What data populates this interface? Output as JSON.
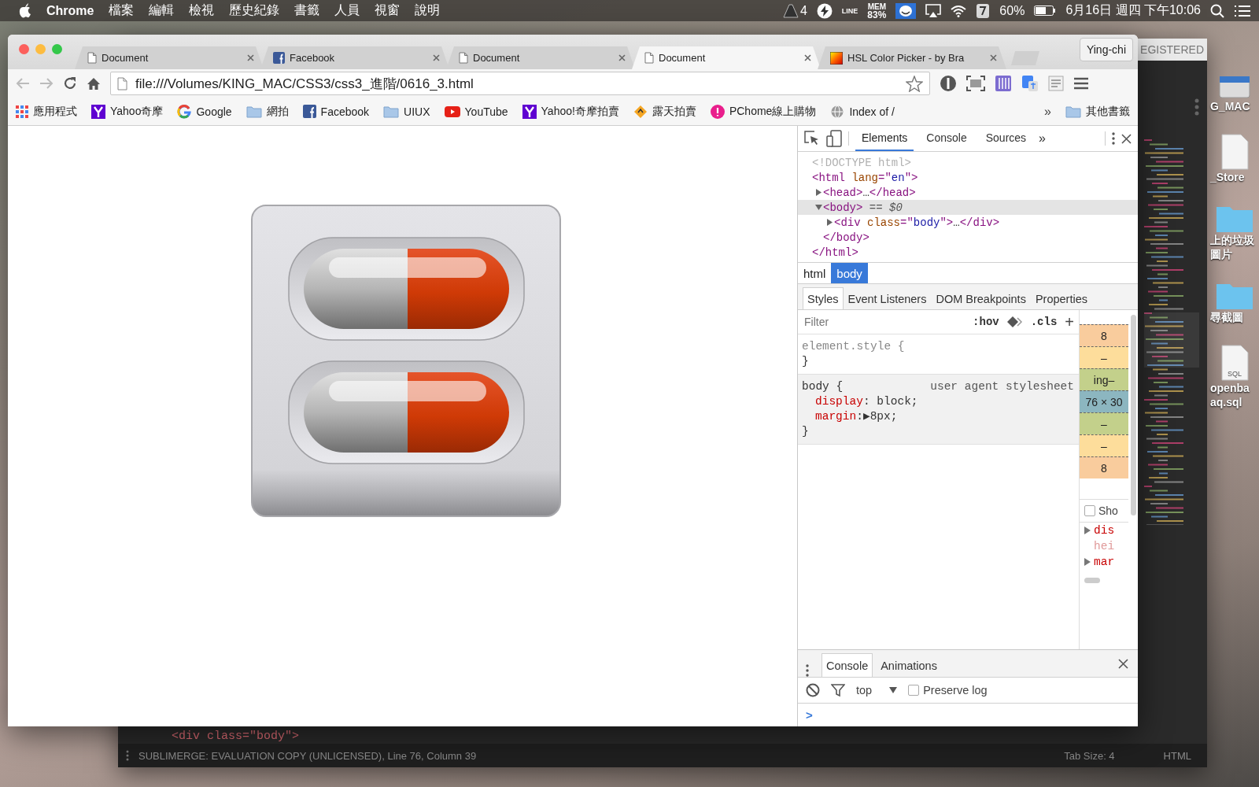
{
  "menu_bar": {
    "app": "Chrome",
    "menus": [
      "檔案",
      "編輯",
      "檢視",
      "歷史紀錄",
      "書籤",
      "人員",
      "視窗",
      "說明"
    ],
    "adobe_count": "4",
    "line_label": "LINE",
    "mem_label": "MEM",
    "mem_value": "83%",
    "battery_percent": "60%",
    "clock": "6月16日 週四 下午10:06"
  },
  "background_window": {
    "title": "EGISTERED",
    "code_line": "<div class=\"body\">",
    "status": "SUBLIMERGE: EVALUATION COPY (UNLICENSED), Line 76, Column 39",
    "tab_size": "Tab Size: 4",
    "syntax": "HTML"
  },
  "desktop_icons": [
    {
      "kind": "drive",
      "label": "G_MAC"
    },
    {
      "kind": "file",
      "label": "_Store"
    },
    {
      "kind": "folder",
      "label": "上的垃圾圖片"
    },
    {
      "kind": "folder",
      "label": "尋截圖"
    },
    {
      "kind": "sql",
      "badge": "SQL",
      "label": "openba\naq.sql"
    }
  ],
  "browser": {
    "tabs": [
      {
        "title": "Document",
        "kind": "page",
        "selected": false
      },
      {
        "title": "Facebook",
        "kind": "facebook",
        "selected": false
      },
      {
        "title": "Document",
        "kind": "page",
        "selected": false
      },
      {
        "title": "Document",
        "kind": "page",
        "selected": true
      },
      {
        "title": "HSL Color Picker - by Bra",
        "kind": "swatch",
        "selected": false
      }
    ],
    "profile": "Ying-chi",
    "url": "file:///Volumes/KING_MAC/CSS3/css3_進階/0616_3.html",
    "bookmarks": [
      {
        "kind": "apps",
        "label": "應用程式"
      },
      {
        "kind": "yahoo",
        "label": "Yahoo奇摩"
      },
      {
        "kind": "google",
        "label": "Google"
      },
      {
        "kind": "folder",
        "label": "網拍"
      },
      {
        "kind": "facebook",
        "label": "Facebook"
      },
      {
        "kind": "folder",
        "label": "UIUX"
      },
      {
        "kind": "youtube",
        "label": "YouTube"
      },
      {
        "kind": "yahoo",
        "label": "Yahoo!奇摩拍賣"
      },
      {
        "kind": "ruten",
        "label": "露天拍賣"
      },
      {
        "kind": "pchome",
        "label": "PChome線上購物"
      },
      {
        "kind": "globe",
        "label": "Index of /"
      }
    ],
    "bookmarks_overflow": "»",
    "other_bookmarks": "其他書籤"
  },
  "devtools": {
    "tabs": [
      {
        "label": "Elements",
        "selected": true
      },
      {
        "label": "Console",
        "selected": false
      },
      {
        "label": "Sources",
        "selected": false
      }
    ],
    "more_tabs": "»",
    "dom_tree": [
      {
        "selected": false,
        "tokens": [
          {
            "kind": "doctype",
            "text": "<!DOCTYPE html>"
          }
        ]
      },
      {
        "selected": false,
        "tokens": [
          {
            "kind": "tag",
            "text": "<html"
          },
          {
            "kind": "attr",
            "text": " lang"
          },
          {
            "kind": "punct",
            "text": "=\""
          },
          {
            "kind": "value",
            "text": "en"
          },
          {
            "kind": "punct",
            "text": "\">"
          }
        ],
        "children": [
          {
            "selected": false,
            "expanded": false,
            "tokens": [
              {
                "kind": "tag",
                "text": "<head>"
              },
              {
                "kind": "text",
                "text": "…"
              },
              {
                "kind": "tag",
                "text": "</head>"
              }
            ]
          },
          {
            "selected": true,
            "expanded": true,
            "tokens": [
              {
                "kind": "tag",
                "text": "<body>"
              },
              {
                "kind": "marker",
                "text": " == $0"
              }
            ],
            "children": [
              {
                "selected": false,
                "expanded": false,
                "tokens": [
                  {
                    "kind": "tag",
                    "text": "<div"
                  },
                  {
                    "kind": "attr",
                    "text": " class"
                  },
                  {
                    "kind": "punct",
                    "text": "=\""
                  },
                  {
                    "kind": "value",
                    "text": "body"
                  },
                  {
                    "kind": "punct",
                    "text": "\">"
                  },
                  {
                    "kind": "text",
                    "text": "…"
                  },
                  {
                    "kind": "tag",
                    "text": "</div>"
                  }
                ]
              }
            ],
            "closing": [
              {
                "kind": "tag",
                "text": "</body>"
              }
            ]
          }
        ],
        "closing": [
          {
            "kind": "tag",
            "text": "</html>"
          }
        ]
      }
    ],
    "breadcrumbs": [
      {
        "label": "html",
        "selected": false
      },
      {
        "label": "body",
        "selected": true
      }
    ],
    "pane_tabs": [
      {
        "label": "Styles",
        "selected": true
      },
      {
        "label": "Event Listeners",
        "selected": false
      },
      {
        "label": "DOM Breakpoints",
        "selected": false
      },
      {
        "label": "Properties",
        "selected": false
      }
    ],
    "filter": {
      "placeholder": "Filter",
      "hov": ":hov",
      "cls": ".cls",
      "add": "+"
    },
    "rules": [
      {
        "kind": "inline",
        "selector": "element.style {",
        "end": "}"
      },
      {
        "kind": "user-agent",
        "selector": "body {",
        "source": "user agent stylesheet",
        "declarations": [
          {
            "property": "display",
            "value": ": block;"
          },
          {
            "property": "margin",
            "value": ":▶8px;"
          }
        ],
        "end": "}"
      }
    ],
    "box_model": [
      {
        "kind": "margin",
        "text": "8"
      },
      {
        "kind": "border",
        "text": "–"
      },
      {
        "kind": "padding",
        "text": "ing–"
      },
      {
        "kind": "content",
        "text": "76 × 30"
      },
      {
        "kind": "padding",
        "text": "–"
      },
      {
        "kind": "border",
        "text": "–"
      },
      {
        "kind": "margin",
        "text": "8"
      }
    ],
    "show_all": {
      "label": "Sho",
      "checked": false
    },
    "computed": [
      {
        "name": "dis",
        "expandable": true,
        "inherited": false
      },
      {
        "name": "hei",
        "expandable": false,
        "inherited": true
      },
      {
        "name": "mar",
        "expandable": true,
        "inherited": false
      }
    ],
    "drawer": {
      "tabs": [
        {
          "label": "Console",
          "selected": true
        },
        {
          "label": "Animations",
          "selected": false
        }
      ],
      "context": "top",
      "preserve_log": {
        "label": "Preserve log",
        "checked": false
      },
      "prompt": ">"
    }
  }
}
